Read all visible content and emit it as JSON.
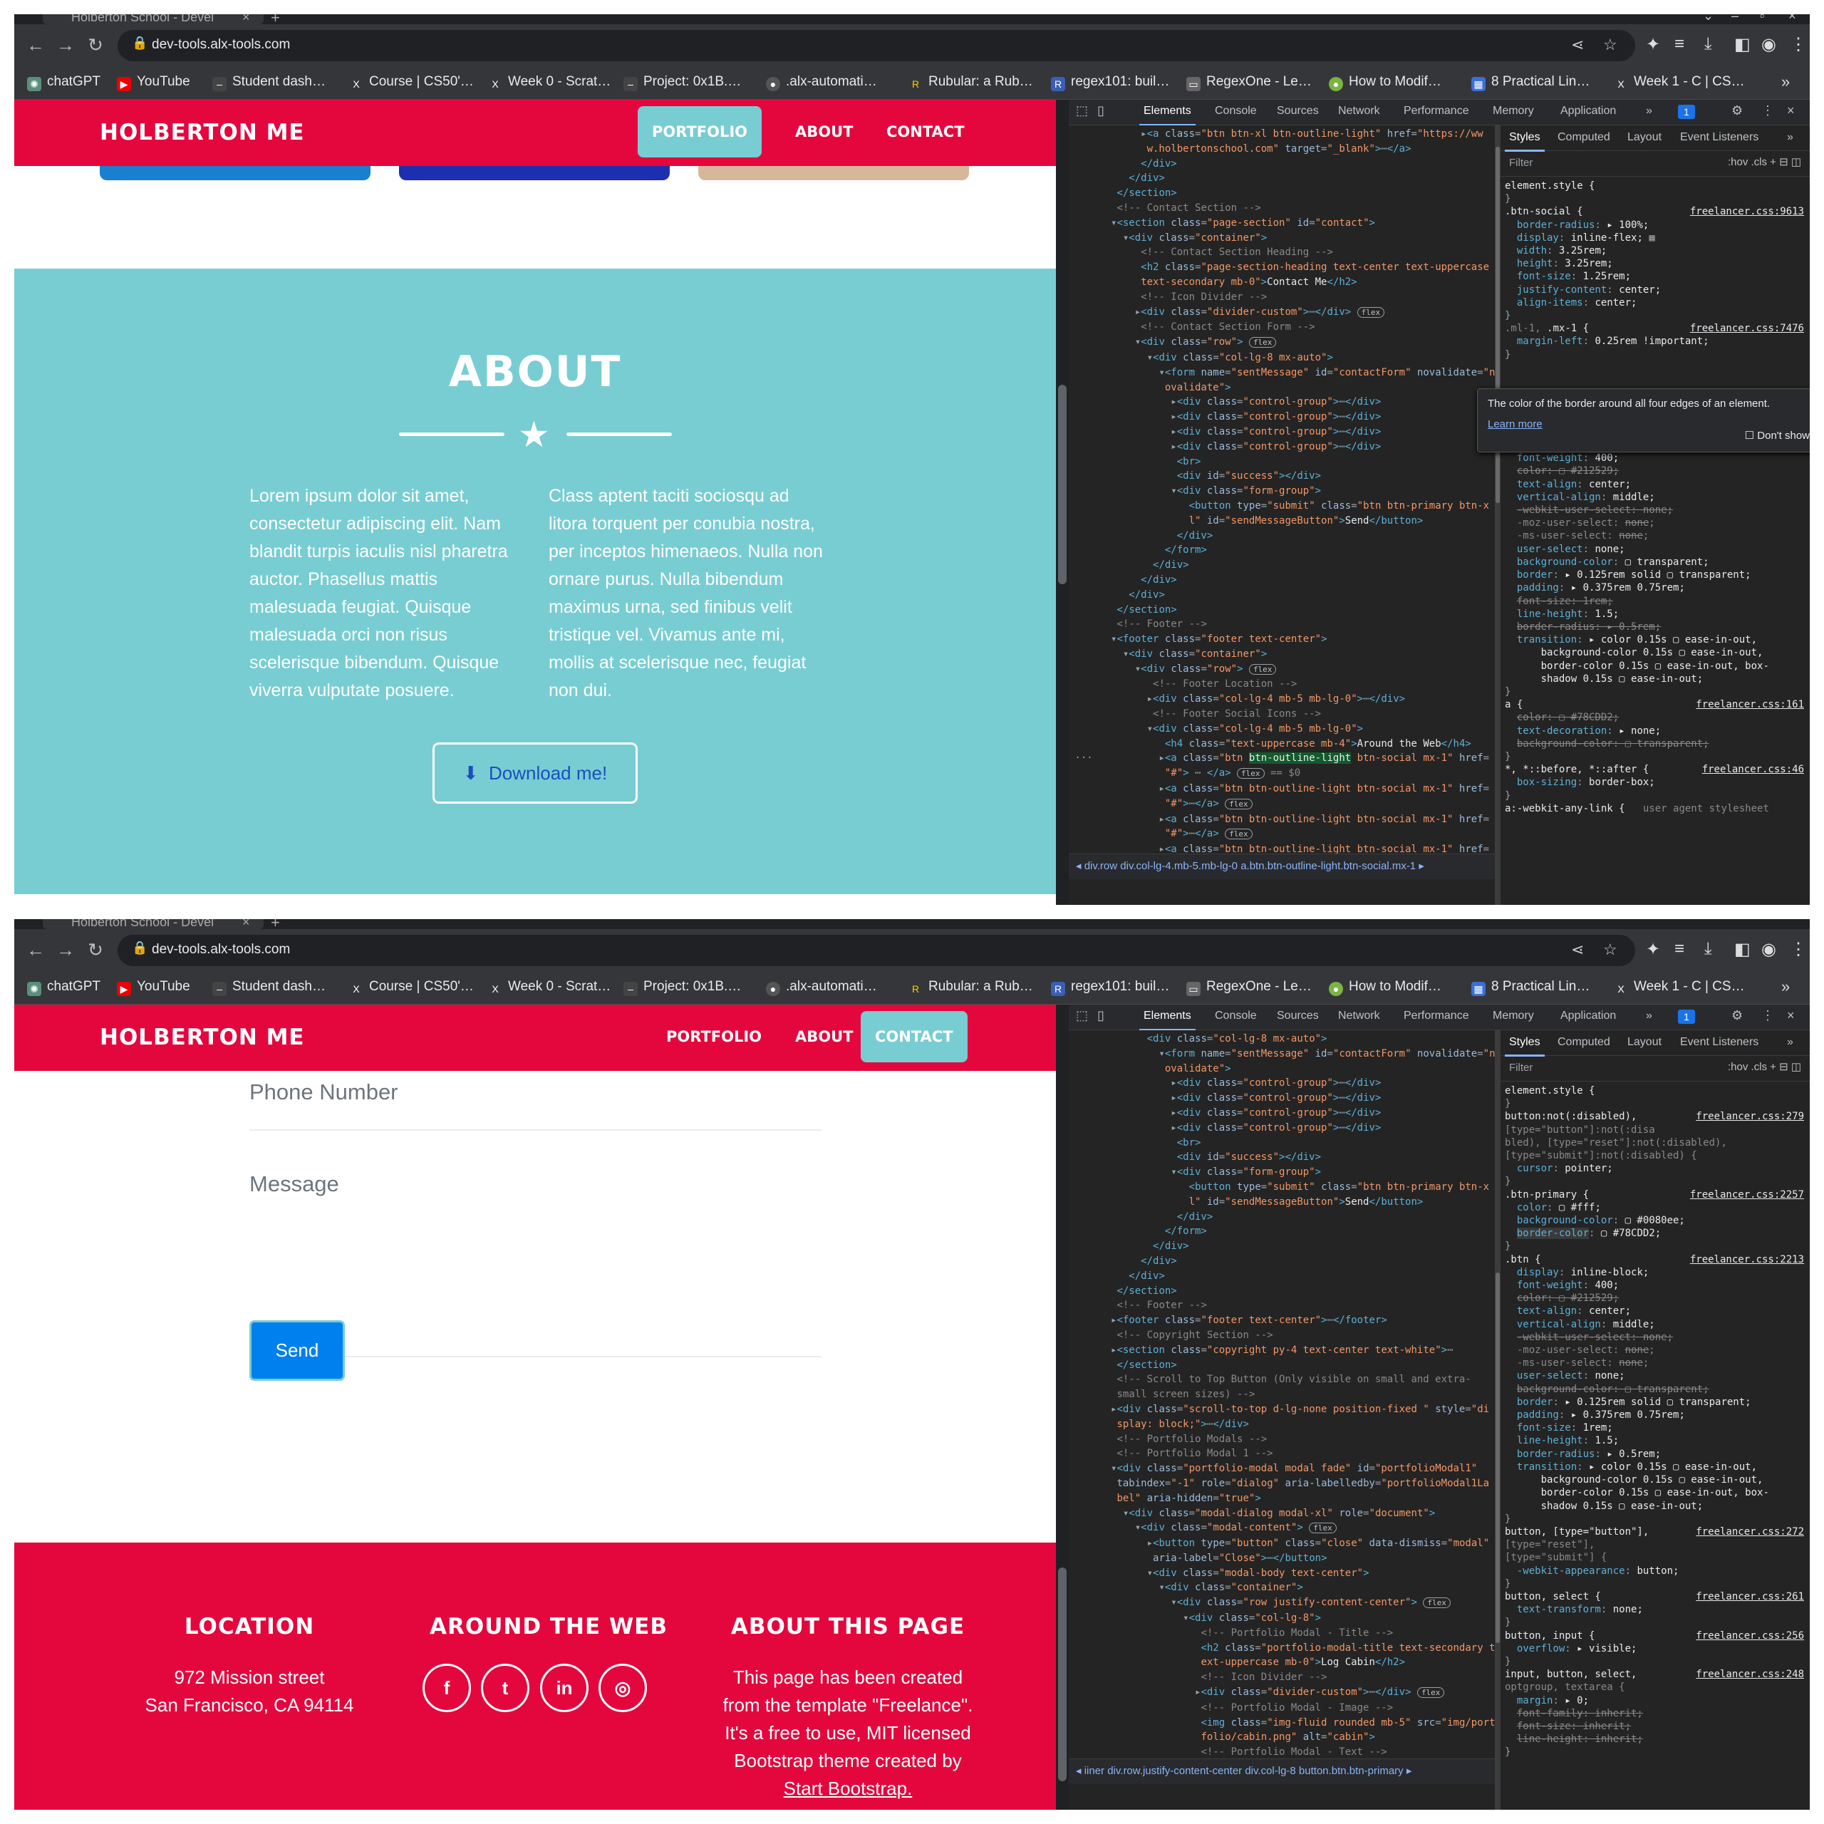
{
  "browser": {
    "tab_title": "Holberton School - Devel",
    "url": "dev-tools.alx-tools.com",
    "bookmarks": [
      "chatGPT",
      "YouTube",
      "Student dash…",
      "Course | CS50'…",
      "Week 0 - Scrat…",
      "Project: 0x1B.…",
      ".alx-automati…",
      "Rubular: a Rub…",
      "regex101: buil…",
      "RegexOne - Le…",
      "How to Modif…",
      "8 Practical Lin…",
      "Week 1 - C | CS…"
    ],
    "bookmark_icons": [
      "openai-icon",
      "youtube-icon",
      "student-icon",
      "x-icon",
      "x-icon",
      "link-icon",
      "github-icon",
      "rubular-icon",
      "regex101-icon",
      "regexone-icon",
      "green-circle-icon",
      "grid-icon",
      "x-icon"
    ]
  },
  "site": {
    "brand": "HOLBERTON ME",
    "nav": [
      "PORTFOLIO",
      "ABOUT",
      "CONTACT"
    ],
    "active_nav_top": "PORTFOLIO",
    "active_nav_bottom": "CONTACT",
    "colors": {
      "navbar": "#e4073d",
      "accent": "#78cdd2",
      "primary": "#0080ee"
    },
    "about": {
      "heading": "ABOUT",
      "col1": "Lorem ipsum dolor sit amet, consectetur adipiscing elit. Nam blandit turpis iaculis nisl pharetra auctor. Phasellus mattis malesuada feugiat. Quisque malesuada orci non risus scelerisque bibendum. Quisque viverra vulputate posuere.",
      "col2": "Class aptent taciti sociosqu ad litora torquent per conubia nostra, per inceptos himenaeos. Nulla non ornare purus. Nulla bibendum maximus urna, sed finibus velit tristique vel. Vivamus ante mi, mollis at scelerisque nec, feugiat non dui.",
      "download": "Download me!"
    },
    "contact": {
      "phone_label": "Phone Number",
      "message_label": "Message",
      "send": "Send"
    },
    "footer": {
      "location_h": "LOCATION",
      "location_l1": "972 Mission street",
      "location_l2": "San Francisco, CA 94114",
      "web_h": "AROUND THE WEB",
      "social": [
        "f",
        "t",
        "in",
        "◎"
      ],
      "about_h": "ABOUT THIS PAGE",
      "about_text": "This page has been created from the template \"Freelance\". It's a free to use, MIT licensed Bootstrap theme created by",
      "about_link": "Start Bootstrap."
    }
  },
  "devtools": {
    "tabs": [
      "Elements",
      "Console",
      "Sources",
      "Network",
      "Performance",
      "Memory",
      "Application"
    ],
    "issues_badge": "1",
    "style_tabs": [
      "Styles",
      "Computed",
      "Layout",
      "Event Listeners"
    ],
    "filter_placeholder": "Filter",
    "filter_opts": ":hov  .cls  +",
    "tooltip": {
      "text": "The color of the border around all four edges of an element.",
      "link": "Learn more",
      "dont_show": "Don't show"
    },
    "breadcrumb_top": "◂  div.row   div.col-lg-4.mb-5.mb-lg-0   a.btn.btn-outline-light.btn-social.mx-1  ▸",
    "breadcrumb_bottom": "◂  iiner   div.row.justify-content-center   div.col-lg-8   button.btn.btn-primary  ▸"
  }
}
